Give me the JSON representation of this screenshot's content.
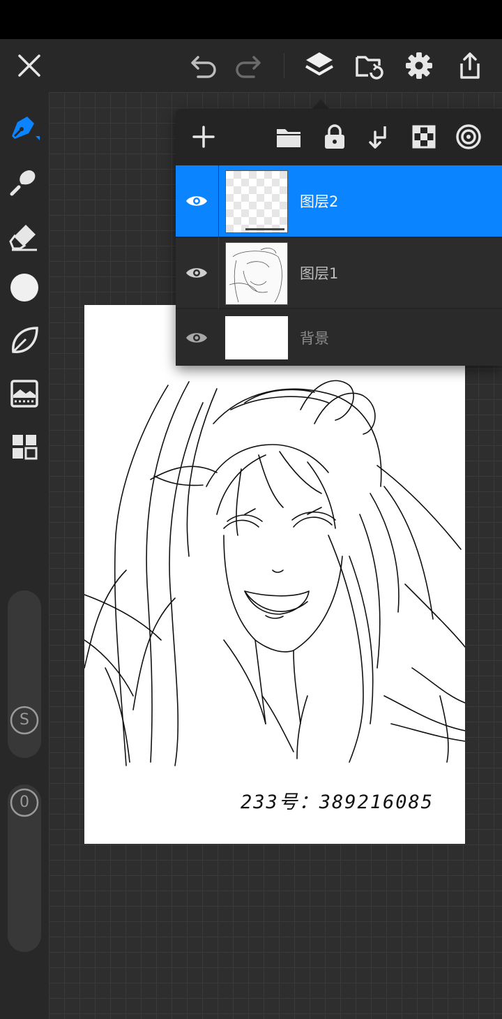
{
  "colors": {
    "accent": "#0a84ff",
    "icon": "#e6e6e6",
    "panel_bg": "#242424",
    "top_bar_bg": "#282828"
  },
  "top_bar": {
    "icons": [
      "close-icon",
      "undo-icon",
      "redo-icon",
      "layers-icon",
      "import-icon",
      "settings-icon",
      "share-icon"
    ]
  },
  "sidebar": {
    "tools": [
      "pen-icon",
      "smudge-icon",
      "eraser-icon",
      "color-swatch",
      "shape-icon",
      "image-icon",
      "grid-icon"
    ],
    "size_slider_label": "S",
    "opacity_slider_label": "0"
  },
  "layers_panel": {
    "toolbar_icons": [
      "add-icon",
      "folder-icon",
      "lock-icon",
      "merge-down-icon",
      "alpha-lock-icon",
      "blend-icon"
    ],
    "layers": [
      {
        "name": "图层2",
        "selected": true
      },
      {
        "name": "图层1",
        "selected": false
      },
      {
        "name": "背景",
        "selected": false
      }
    ]
  },
  "canvas": {
    "caption": "233号：389216085"
  }
}
